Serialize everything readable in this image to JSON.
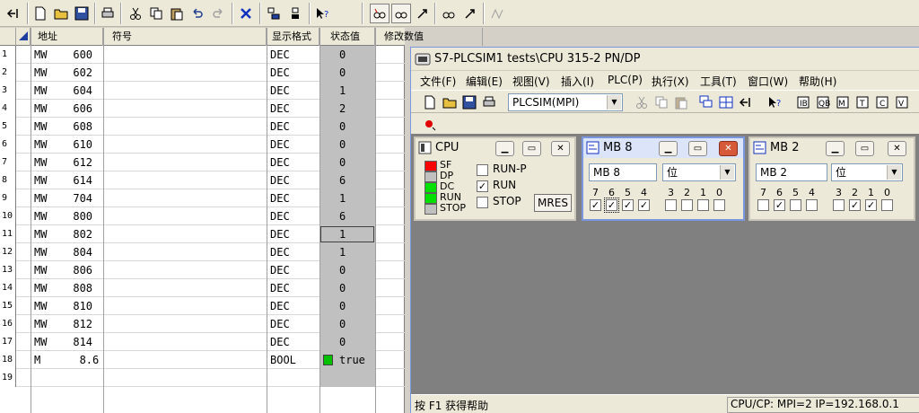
{
  "toolbar": {
    "icons": [
      "insert-row-icon",
      "new-icon",
      "open-icon",
      "save-icon",
      "print-icon",
      "cut-icon",
      "copy-icon",
      "paste-icon",
      "undo-icon",
      "redo-icon",
      "delete-icon",
      "monitor-icon",
      "modify-icon",
      "help-pointer-icon",
      "glasses-icon",
      "trigger-icon",
      "monitor-trigger-icon",
      "modify-trigger-icon",
      "force-icon"
    ]
  },
  "table": {
    "headers": {
      "address": "地址",
      "symbol": "符号",
      "format": "显示格式",
      "status": "状态值",
      "modify": "修改数值"
    },
    "rows": [
      {
        "n": "1",
        "addr": "MW    600",
        "fmt": "DEC",
        "val": "0"
      },
      {
        "n": "2",
        "addr": "MW    602",
        "fmt": "DEC",
        "val": "0"
      },
      {
        "n": "3",
        "addr": "MW    604",
        "fmt": "DEC",
        "val": "1"
      },
      {
        "n": "4",
        "addr": "MW    606",
        "fmt": "DEC",
        "val": "2"
      },
      {
        "n": "5",
        "addr": "MW    608",
        "fmt": "DEC",
        "val": "0"
      },
      {
        "n": "6",
        "addr": "MW    610",
        "fmt": "DEC",
        "val": "0"
      },
      {
        "n": "7",
        "addr": "MW    612",
        "fmt": "DEC",
        "val": "0"
      },
      {
        "n": "8",
        "addr": "MW    614",
        "fmt": "DEC",
        "val": "6"
      },
      {
        "n": "9",
        "addr": "MW    704",
        "fmt": "DEC",
        "val": "1"
      },
      {
        "n": "10",
        "addr": "MW    800",
        "fmt": "DEC",
        "val": "6"
      },
      {
        "n": "11",
        "addr": "MW    802",
        "fmt": "DEC",
        "val": "1"
      },
      {
        "n": "12",
        "addr": "MW    804",
        "fmt": "DEC",
        "val": "1"
      },
      {
        "n": "13",
        "addr": "MW    806",
        "fmt": "DEC",
        "val": "0"
      },
      {
        "n": "14",
        "addr": "MW    808",
        "fmt": "DEC",
        "val": "0"
      },
      {
        "n": "15",
        "addr": "MW    810",
        "fmt": "DEC",
        "val": "0"
      },
      {
        "n": "16",
        "addr": "MW    812",
        "fmt": "DEC",
        "val": "0"
      },
      {
        "n": "17",
        "addr": "MW    814",
        "fmt": "DEC",
        "val": "0"
      },
      {
        "n": "18",
        "addr": "M      8.6",
        "fmt": "BOOL",
        "val": "true"
      },
      {
        "n": "19",
        "addr": "",
        "fmt": "",
        "val": ""
      }
    ],
    "selected_row": 10,
    "status_col_color": "#c0c0c0",
    "bool_true_color": "#00c000"
  },
  "plcsim": {
    "title": "S7-PLCSIM1    tests\\CPU 315-2 PN/DP",
    "menu": [
      "文件(F)",
      "编辑(E)",
      "视图(V)",
      "插入(I)",
      "PLC(P)",
      "执行(X)",
      "工具(T)",
      "窗口(W)",
      "帮助(H)"
    ],
    "interface": "PLCSIM(MPI)",
    "status_left": "按 F1 获得帮助",
    "status_right": "CPU/CP:  MPI=2 IP=192.168.0.1"
  },
  "cpu": {
    "title": "CPU",
    "leds": [
      {
        "label": "SF",
        "color": "#ff0000"
      },
      {
        "label": "DP",
        "color": "#c0c0c0"
      },
      {
        "label": "DC",
        "color": "#00e000"
      },
      {
        "label": "RUN",
        "color": "#00e000"
      },
      {
        "label": "STOP",
        "color": "#c0c0c0"
      }
    ],
    "modes": [
      {
        "label": "RUN-P",
        "checked": false
      },
      {
        "label": "RUN",
        "checked": true
      },
      {
        "label": "STOP",
        "checked": false
      }
    ],
    "mres_label": "MRES"
  },
  "mb8": {
    "title": "MB    8",
    "field": "MB      8",
    "fmt": "位",
    "bits": [
      "7",
      "6",
      "5",
      "4",
      "3",
      "2",
      "1",
      "0"
    ],
    "checked": [
      true,
      true,
      true,
      true,
      false,
      false,
      false,
      false
    ]
  },
  "mb2": {
    "title": "MB    2",
    "field": "MB      2",
    "fmt": "位",
    "bits": [
      "7",
      "6",
      "5",
      "4",
      "3",
      "2",
      "1",
      "0"
    ],
    "checked": [
      false,
      true,
      false,
      false,
      false,
      true,
      true,
      false
    ]
  }
}
